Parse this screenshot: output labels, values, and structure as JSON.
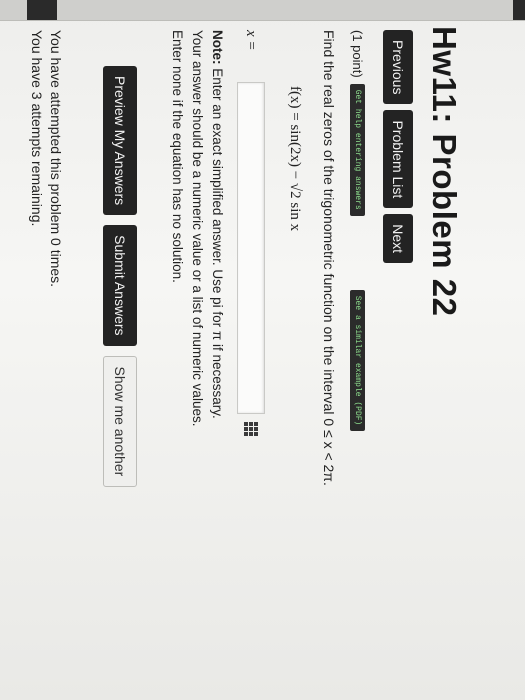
{
  "title": "Hw11: Problem 22",
  "nav": {
    "previous": "Previous",
    "problem_list": "Problem List",
    "next": "Next"
  },
  "problem": {
    "points": "(1 point)",
    "help_link": "Get help entering answers",
    "example_link": "See a similar example (PDF)",
    "prompt": "Find the real zeros of the trigonometric function on the interval 0 ≤ x < 2π.",
    "function": "f(x) = sin(2x) − √2 sin x",
    "answer_label": "x =",
    "answer_value": ""
  },
  "note": {
    "label": "Note:",
    "line1": "Enter an exact simplified answer. Use pi for π if necessary.",
    "line2": "Your answer should be a numeric value or a list of numeric values.",
    "line3": "Enter none if the equation has no solution."
  },
  "actions": {
    "preview": "Preview My Answers",
    "submit": "Submit Answers",
    "show_another": "Show me another"
  },
  "status": {
    "line1": "You have attempted this problem 0 times.",
    "line2": "You have 3 attempts remaining."
  }
}
